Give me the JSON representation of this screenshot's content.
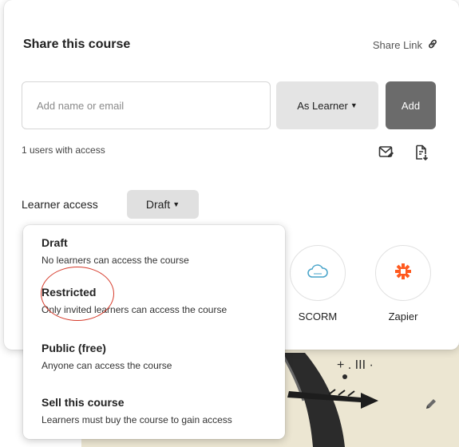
{
  "modal": {
    "title": "Share this course",
    "share_link_label": "Share Link",
    "input_placeholder": "Add name or email",
    "role_label": "As Learner",
    "add_label": "Add",
    "users_count": "1 users with access",
    "learner_access_label": "Learner access",
    "access_value": "Draft"
  },
  "integrations": [
    {
      "label": "SCORM",
      "icon": "cloud-icon",
      "color": "#46a3c9"
    },
    {
      "label": "Zapier",
      "icon": "zapier-asterisk-icon",
      "color": "#ff5a1f"
    }
  ],
  "dropdown": {
    "options": [
      {
        "title": "Draft",
        "desc": "No learners can access the course"
      },
      {
        "title": "Restricted",
        "desc": "Only invited learners can access the course"
      },
      {
        "title": "Public (free)",
        "desc": "Anyone can access the course"
      },
      {
        "title": "Sell this course",
        "desc": "Learners must buy the course to gain access"
      }
    ],
    "highlighted_option": "Restricted",
    "annotation_color": "#d63a2a"
  }
}
